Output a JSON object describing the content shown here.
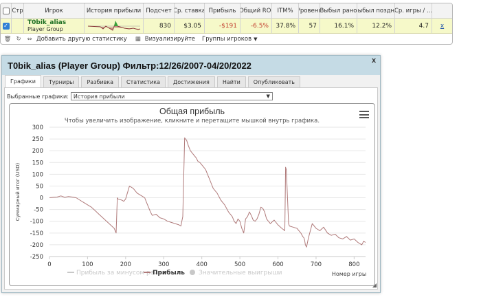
{
  "grid": {
    "headers": [
      "Стр",
      "Игрок",
      "История прибыли",
      "Подсчет",
      "Ср. ставка",
      "Прибыль",
      "Общий ROI",
      "ITM%",
      "Уровень",
      "Выбыл рано",
      "Выбыл поздно",
      "Ср. игры / ...",
      ""
    ],
    "row": {
      "player_name": "T0bik_alias",
      "player_group": "Player Group",
      "count": "830",
      "avg_stake": "$3.05",
      "profit": "-$191",
      "roi": "-6.5%",
      "itm": "37.8%",
      "level": "57",
      "early_exit": "16.1%",
      "late_exit": "12.2%",
      "avg_games": "4.7",
      "remove_label": "x"
    },
    "toolbar": {
      "add_stats_label": "Добавить другую статистику",
      "visualize_label": "Визуализируйте",
      "groups_label": "Группы игроков"
    }
  },
  "dialog": {
    "title": "T0bik_alias (Player Group) Фильтр:12/26/2007-04/20/2022",
    "close_label": "x",
    "tabs": [
      "Графики",
      "Турниры",
      "Разбивка",
      "Статистика",
      "Достижения",
      "Найти",
      "Опубликовать"
    ],
    "selected_graphs_label": "Выбранные графики:",
    "selected_graph_value": "История прибыли"
  },
  "colors": {
    "profit_line": "#b07a7a",
    "row_highlight": "#f6f9c9",
    "title_bar": "#c5dbe5"
  },
  "chart_data": {
    "type": "line",
    "title": "Общая прибыль",
    "subtitle": "Чтобы увеличить изображение, кликните и перетащите мышкой внутрь графика.",
    "xlabel": "Номер игры",
    "ylabel": "Суммарный итог (USD)",
    "xlim": [
      0,
      830
    ],
    "ylim": [
      -250,
      300
    ],
    "xticks": [
      0,
      100,
      200,
      300,
      400,
      500,
      600,
      700,
      800
    ],
    "yticks": [
      300,
      250,
      200,
      150,
      100,
      50,
      0,
      -50,
      -100,
      -150,
      -200,
      -250
    ],
    "grid": true,
    "legend_position": "bottom",
    "legend": [
      {
        "name": "Прибыль за минусом рейка",
        "active": false
      },
      {
        "name": "Прибыль",
        "active": true
      },
      {
        "name": "Значительные выигрыши",
        "active": false
      }
    ],
    "series": [
      {
        "name": "Прибыль",
        "x": [
          0,
          10,
          20,
          30,
          40,
          50,
          60,
          70,
          80,
          90,
          100,
          110,
          120,
          130,
          140,
          150,
          160,
          170,
          175,
          178,
          180,
          190,
          195,
          200,
          210,
          220,
          230,
          235,
          240,
          245,
          250,
          255,
          260,
          265,
          270,
          280,
          290,
          300,
          310,
          320,
          330,
          340,
          345,
          350,
          355,
          357,
          360,
          365,
          370,
          375,
          380,
          385,
          390,
          395,
          400,
          405,
          410,
          415,
          420,
          425,
          430,
          440,
          450,
          460,
          470,
          480,
          485,
          490,
          495,
          500,
          505,
          510,
          515,
          520,
          525,
          530,
          535,
          540,
          545,
          550,
          555,
          560,
          565,
          570,
          580,
          590,
          600,
          610,
          618,
          620,
          622,
          625,
          628,
          630,
          640,
          650,
          655,
          660,
          665,
          668,
          670,
          672,
          675,
          680,
          690,
          700,
          710,
          720,
          730,
          740,
          750,
          760,
          770,
          780,
          790,
          800,
          810,
          815,
          820,
          825,
          830
        ],
        "y": [
          0,
          2,
          3,
          8,
          2,
          5,
          3,
          0,
          -10,
          -20,
          -30,
          -40,
          -55,
          -70,
          -85,
          -100,
          -115,
          -130,
          -150,
          0,
          -5,
          -10,
          -15,
          -5,
          50,
          40,
          20,
          15,
          10,
          5,
          0,
          -20,
          -40,
          -60,
          -75,
          -70,
          -85,
          -90,
          -100,
          -105,
          -110,
          -115,
          -120,
          -80,
          255,
          250,
          245,
          220,
          200,
          190,
          180,
          170,
          155,
          150,
          140,
          130,
          120,
          100,
          80,
          60,
          40,
          20,
          -10,
          -30,
          -60,
          -80,
          -100,
          -110,
          -90,
          -100,
          -130,
          -150,
          -90,
          -80,
          -60,
          -75,
          -95,
          -100,
          -90,
          -70,
          -40,
          -45,
          -60,
          -90,
          -110,
          -95,
          -115,
          -130,
          -140,
          130,
          120,
          0,
          -110,
          -120,
          -125,
          -130,
          -140,
          -150,
          -165,
          -170,
          -180,
          -200,
          -210,
          -170,
          -110,
          -130,
          -140,
          -125,
          -150,
          -160,
          -155,
          -170,
          -175,
          -165,
          -180,
          -175,
          -190,
          -195,
          -200,
          -185,
          -190
        ]
      }
    ]
  }
}
